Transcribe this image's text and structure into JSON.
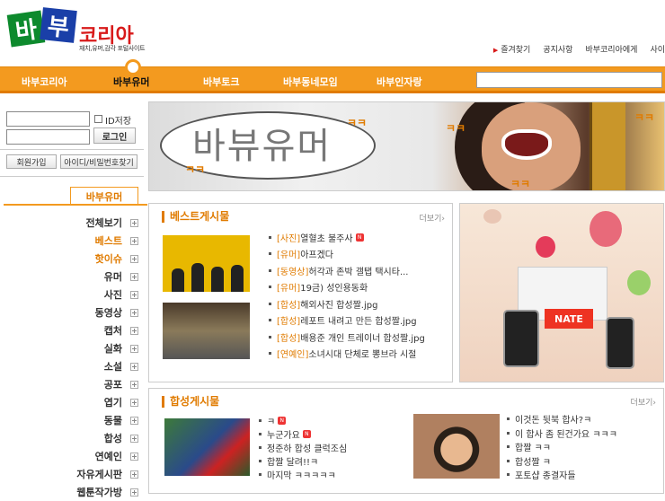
{
  "logo": {
    "char1": "바",
    "char2": "부",
    "name": "코리아",
    "subtitle": "재치,유머,감각 포털사이트"
  },
  "top_links": [
    "즐겨찾기",
    "공지사항",
    "바부코리아에게",
    "사이"
  ],
  "nav": {
    "items": [
      "바부코리아",
      "바부유머",
      "바부토크",
      "바부동네모임",
      "바부인자랑"
    ],
    "active_index": 1
  },
  "login": {
    "save_id_label": "ID저장",
    "login_button": "로그인",
    "join_button": "회원가입",
    "find_button": "아이디/비밀번호찾기"
  },
  "sidebar": {
    "tab": "바부유머",
    "items": [
      {
        "label": "전체보기",
        "highlight": false
      },
      {
        "label": "베스트",
        "highlight": true
      },
      {
        "label": "핫이슈",
        "highlight": true
      },
      {
        "label": "유머",
        "highlight": false
      },
      {
        "label": "사진",
        "highlight": false
      },
      {
        "label": "동영상",
        "highlight": false
      },
      {
        "label": "캡처",
        "highlight": false
      },
      {
        "label": "실화",
        "highlight": false
      },
      {
        "label": "소설",
        "highlight": false
      },
      {
        "label": "공포",
        "highlight": false
      },
      {
        "label": "엽기",
        "highlight": false
      },
      {
        "label": "동물",
        "highlight": false
      },
      {
        "label": "합성",
        "highlight": false
      },
      {
        "label": "연예인",
        "highlight": false
      },
      {
        "label": "자유게시판",
        "highlight": false
      },
      {
        "label": "웹툰작가방",
        "highlight": false
      }
    ]
  },
  "banner": {
    "title": "바뷰유머",
    "laugh": "ㅋㅋ"
  },
  "best": {
    "title": "베스트게시물",
    "more": "더보기",
    "items": [
      {
        "cat": "[사진]",
        "text": "열혈초 불주사",
        "new": true
      },
      {
        "cat": "[유머]",
        "text": "아프겠다",
        "new": false
      },
      {
        "cat": "[동영상]",
        "text": "허각과 존박 갤탭 택시타...",
        "new": false
      },
      {
        "cat": "[유머]",
        "text": "19금) 성인용동화",
        "new": false
      },
      {
        "cat": "[합성]",
        "text": "해외사진 합성짤.jpg",
        "new": false
      },
      {
        "cat": "[합성]",
        "text": "레포트 내려고 만든 합성짤.jpg",
        "new": false
      },
      {
        "cat": "[합성]",
        "text": "배용준 개인 트레이너 합성짤.jpg",
        "new": false
      },
      {
        "cat": "[연예인]",
        "text": "소녀시대 단체로 뽕브라 시절",
        "new": false
      }
    ]
  },
  "ad": {
    "brand": "NATE"
  },
  "synth": {
    "title": "합성게시물",
    "more": "더보기",
    "left_items": [
      {
        "text": "ㅋ",
        "new": true
      },
      {
        "text": "누군가요",
        "new": true
      },
      {
        "text": "정준하 합성 클럭조심",
        "new": false
      },
      {
        "text": "합짤 달려!!ㅋ",
        "new": false
      },
      {
        "text": "마지막 ㅋㅋㅋㅋㅋ",
        "new": false
      }
    ],
    "right_items": [
      {
        "text": "이것돈 뒷북 합사?ㅋ"
      },
      {
        "text": "이 합사 좀 된건가요 ㅋㅋㅋ"
      },
      {
        "text": "합짤 ㅋㅋ"
      },
      {
        "text": "합성짤 ㅋ"
      },
      {
        "text": "포토샵 종결자들"
      }
    ]
  },
  "colors": {
    "accent": "#f39a1f",
    "accent_dark": "#e07b00",
    "logo_red": "#d81a1a",
    "logo_green": "#0d8a2d",
    "logo_blue": "#1a3fa8"
  }
}
